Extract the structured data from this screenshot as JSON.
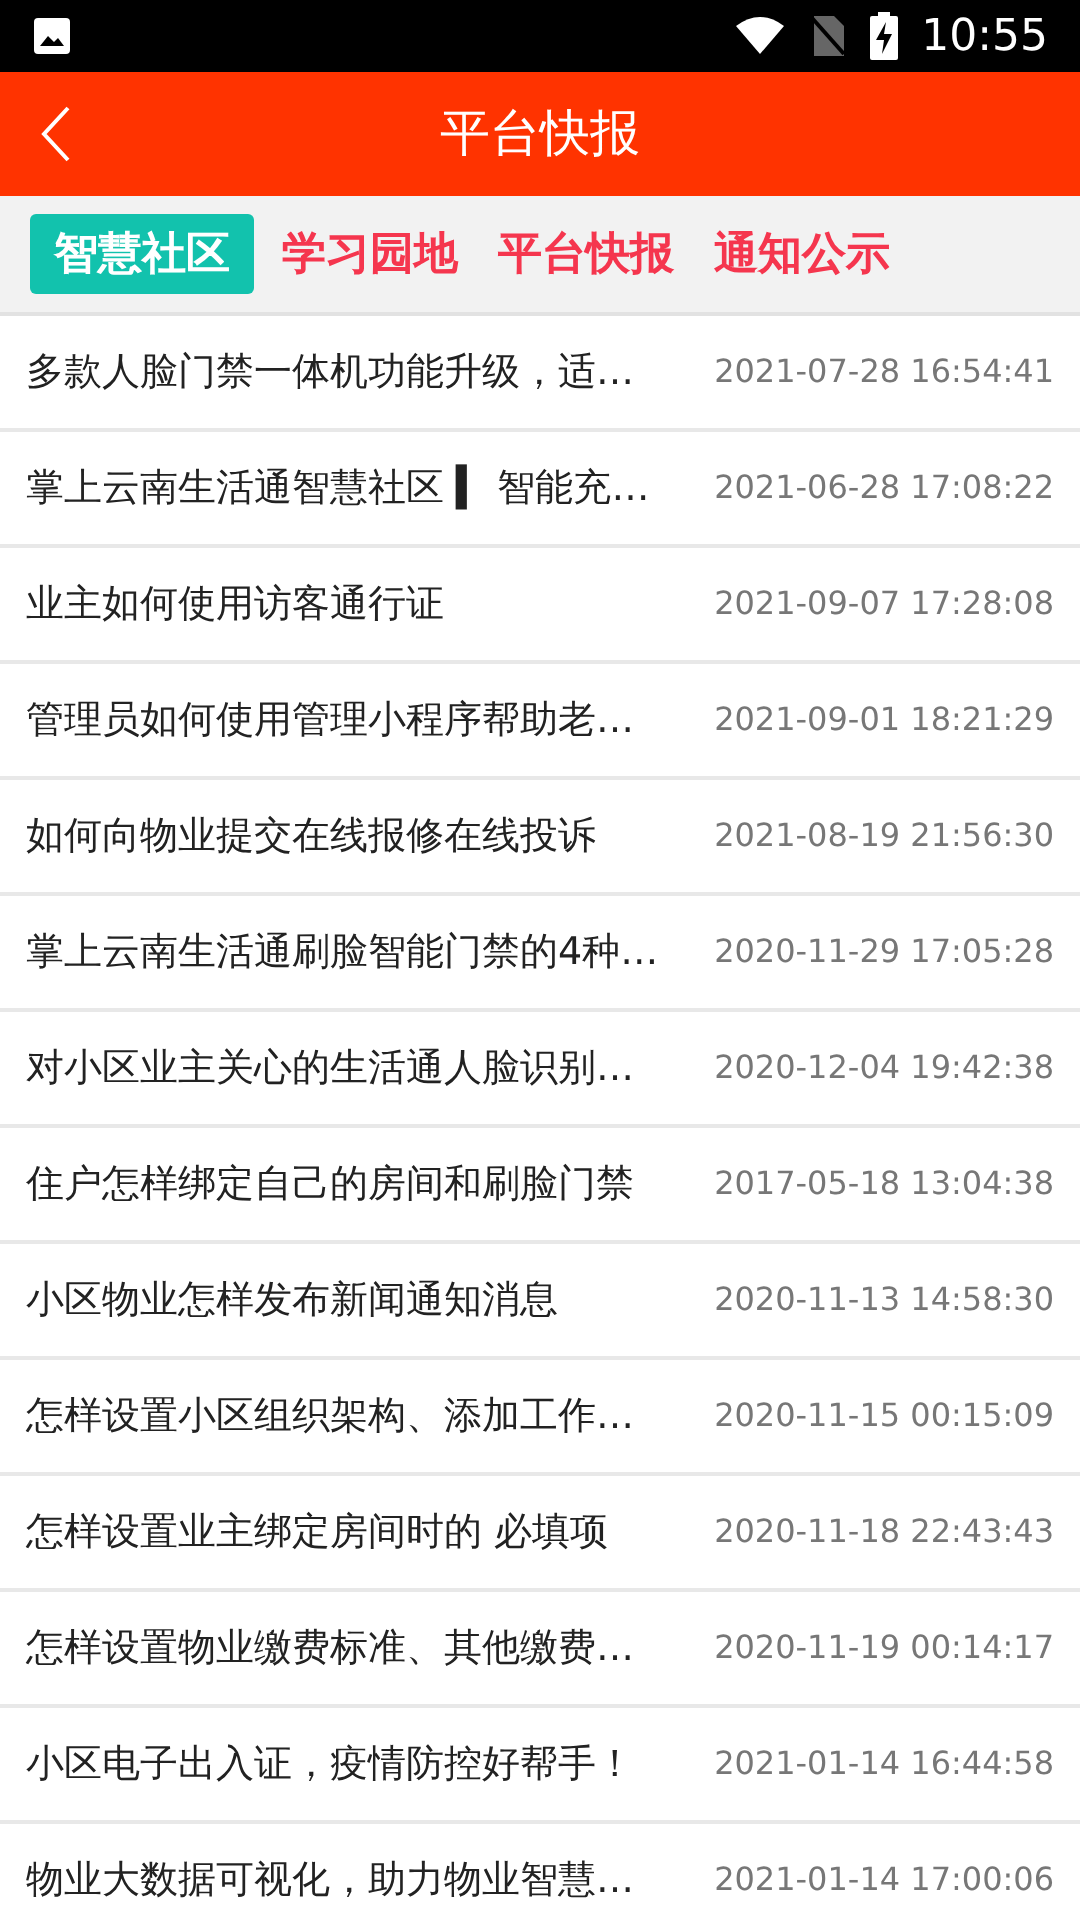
{
  "status_bar": {
    "time": "10:55"
  },
  "header": {
    "title": "平台快报"
  },
  "tabs": [
    {
      "label": "智慧社区",
      "selected": true
    },
    {
      "label": "学习园地",
      "selected": false
    },
    {
      "label": "平台快报",
      "selected": false
    },
    {
      "label": "通知公示",
      "selected": false
    }
  ],
  "articles": [
    {
      "title": "多款人脸门禁一体机功能升级，适…",
      "date": "2021-07-28 16:54:41"
    },
    {
      "title": "掌上云南生活通智慧社区 ▍ 智能充…",
      "date": "2021-06-28 17:08:22"
    },
    {
      "title": "业主如何使用访客通行证",
      "date": "2021-09-07 17:28:08"
    },
    {
      "title": "管理员如何使用管理小程序帮助老…",
      "date": "2021-09-01 18:21:29"
    },
    {
      "title": "如何向物业提交在线报修在线投诉",
      "date": "2021-08-19 21:56:30"
    },
    {
      "title": "掌上云南生活通刷脸智能门禁的4种…",
      "date": "2020-11-29 17:05:28"
    },
    {
      "title": "对小区业主关心的生活通人脸识别…",
      "date": "2020-12-04 19:42:38"
    },
    {
      "title": "住户怎样绑定自己的房间和刷脸门禁",
      "date": "2017-05-18 13:04:38"
    },
    {
      "title": "小区物业怎样发布新闻通知消息",
      "date": "2020-11-13 14:58:30"
    },
    {
      "title": "怎样设置小区组织架构、添加工作…",
      "date": "2020-11-15 00:15:09"
    },
    {
      "title": "怎样设置业主绑定房间时的 必填项",
      "date": "2020-11-18 22:43:43"
    },
    {
      "title": "怎样设置物业缴费标准、其他缴费…",
      "date": "2020-11-19 00:14:17"
    },
    {
      "title": "小区电子出入证，疫情防控好帮手！",
      "date": "2021-01-14 16:44:58"
    },
    {
      "title": "物业大数据可视化，助力物业智慧…",
      "date": "2021-01-14 17:00:06"
    }
  ]
}
